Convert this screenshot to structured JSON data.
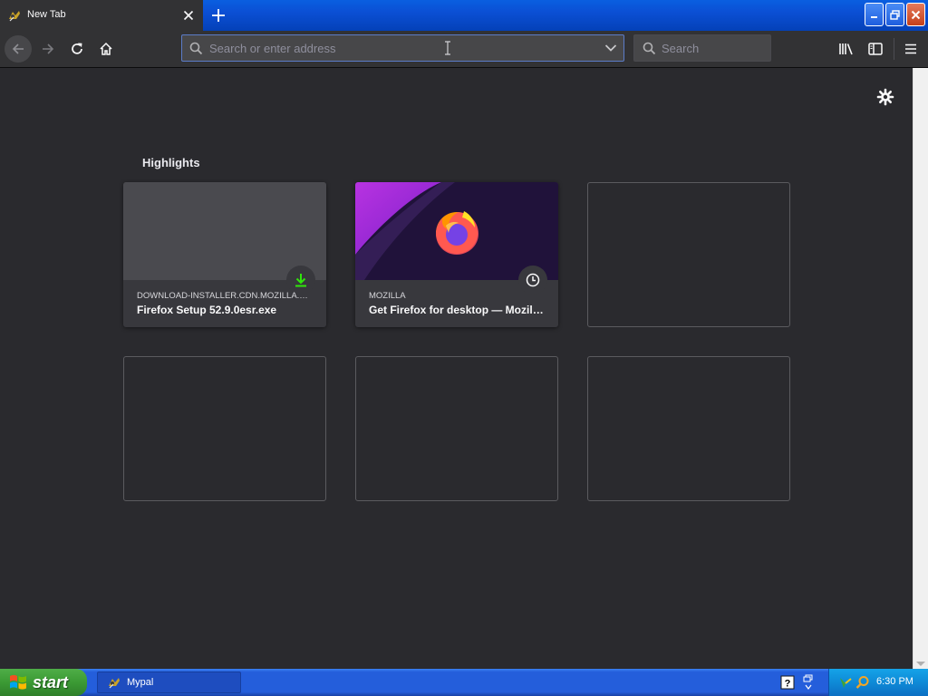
{
  "tab": {
    "title": "New Tab",
    "icon": "mypal-favicon-icon"
  },
  "toolbar": {
    "url_placeholder": "Search or enter address",
    "search_placeholder": "Search"
  },
  "newtab": {
    "section_title": "Highlights",
    "cards": [
      {
        "host": "DOWNLOAD-INSTALLER.CDN.MOZILLA.NET",
        "title": "Firefox Setup 52.9.0esr.exe",
        "badge": "download-icon"
      },
      {
        "host": "MOZILLA",
        "title": "Get Firefox for desktop — Mozilla (US)",
        "badge": "history-clock-icon"
      }
    ]
  },
  "taskbar": {
    "start_label": "start",
    "window_label": "Mypal",
    "clock": "6:30 PM"
  },
  "colors": {
    "page_background": "#2a2a2e",
    "toolbar_background": "#323234",
    "download_badge": "#30e60b",
    "taskbar_blue": "#245edb",
    "start_green": "#3b9a34"
  }
}
